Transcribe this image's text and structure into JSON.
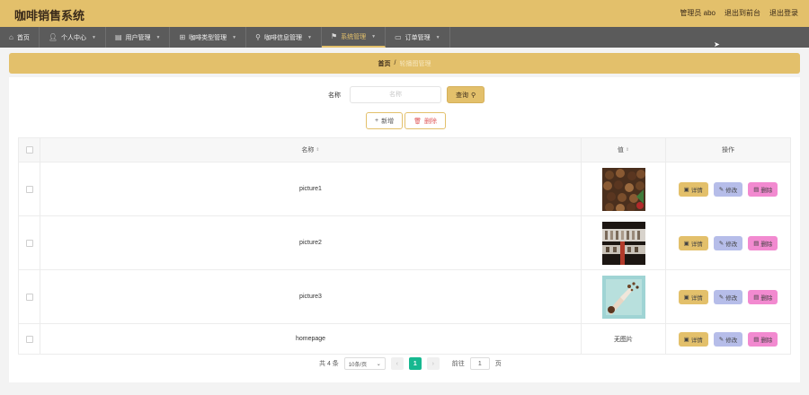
{
  "app": {
    "title": "咖啡销售系统"
  },
  "header": {
    "user_label": "管理员 abo",
    "back_label": "退出到前台",
    "logout_label": "退出登录"
  },
  "nav": {
    "items": [
      {
        "label": "首页",
        "icon": "home-icon"
      },
      {
        "label": "个人中心",
        "icon": "user-icon"
      },
      {
        "label": "用户管理",
        "icon": "users-icon"
      },
      {
        "label": "咖啡类型管理",
        "icon": "grid-icon"
      },
      {
        "label": "咖啡信息管理",
        "icon": "pin-icon"
      },
      {
        "label": "系统管理",
        "icon": "flag-icon",
        "active": true
      },
      {
        "label": "订单管理",
        "icon": "doc-icon"
      }
    ]
  },
  "breadcrumb": {
    "home": "首页",
    "separator": "/",
    "current": "轮播图管理"
  },
  "search": {
    "label": "名称",
    "placeholder": "名称",
    "button_label": "查询"
  },
  "actions": {
    "add_label": "新增",
    "delete_label": "删除"
  },
  "table": {
    "headers": {
      "name": "名称",
      "image": "值",
      "operations": "操作"
    },
    "rows": [
      {
        "name": "picture1",
        "image": "coffee-beans",
        "no_image_text": ""
      },
      {
        "name": "picture2",
        "image": "coffee-shop",
        "no_image_text": ""
      },
      {
        "name": "picture3",
        "image": "coffee-pour",
        "no_image_text": ""
      },
      {
        "name": "homepage",
        "image": "",
        "no_image_text": "无图片"
      }
    ],
    "op_labels": {
      "detail": "详情",
      "edit": "修改",
      "delete": "删除"
    }
  },
  "pagination": {
    "total_text": "共 4 条",
    "page_size": "10条/页",
    "current_page": "1",
    "goto_label": "前往",
    "goto_value": "1",
    "page_suffix": "页"
  },
  "colors": {
    "accent": "#e3c06b",
    "nav_bg": "#5b5b5b",
    "edit_btn": "#b6bde9",
    "delete_btn": "#f28ad0",
    "pager_active": "#17b890"
  }
}
